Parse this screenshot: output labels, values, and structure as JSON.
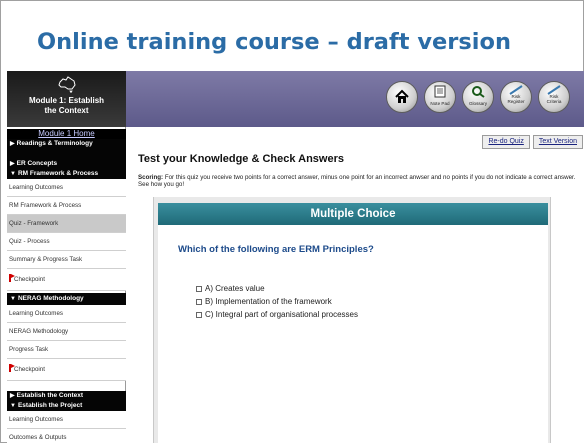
{
  "slide": {
    "title": "Online training course – draft version"
  },
  "brand": {
    "module_line1": "Module 1: Establish",
    "module_line2": "the Context",
    "map_icon": "australia-map-icon"
  },
  "sidebar": {
    "home_link": "Module 1 Home",
    "items": [
      {
        "label": "Readings & Terminology",
        "kind": "section",
        "arrow": "right"
      },
      {
        "label": "ER Concepts",
        "kind": "section",
        "arrow": "right"
      },
      {
        "label": "RM Framework & Process",
        "kind": "section",
        "arrow": "down"
      },
      {
        "label": "Learning Outcomes",
        "kind": "item"
      },
      {
        "label": "RM Framework & Process",
        "kind": "item"
      },
      {
        "label": "Quiz - Framework",
        "kind": "item",
        "active": true
      },
      {
        "label": "Quiz - Process",
        "kind": "item"
      },
      {
        "label": "Summary & Progress Task",
        "kind": "item"
      },
      {
        "label": "Checkpoint",
        "kind": "item",
        "flag": true
      },
      {
        "label": "NERAG Methodology",
        "kind": "section",
        "arrow": "down"
      },
      {
        "label": "Learning Outcomes",
        "kind": "item"
      },
      {
        "label": "NERAG Methodology",
        "kind": "item"
      },
      {
        "label": "Progress Task",
        "kind": "item"
      },
      {
        "label": "Checkpoint",
        "kind": "item",
        "flag": true
      },
      {
        "label": "Establish the Context",
        "kind": "section",
        "arrow": "right"
      },
      {
        "label": "Establish the Project",
        "kind": "section",
        "arrow": "down"
      },
      {
        "label": "Learning Outcomes",
        "kind": "item"
      },
      {
        "label": "Outcomes & Outputs",
        "kind": "item"
      }
    ]
  },
  "toolbar": {
    "home_icon": "home-icon",
    "note_pad": "Note Pad",
    "glossary": "Glossary",
    "risk_register_1": "Risk",
    "risk_register_2": "Register",
    "risk_criteria_1": "Risk",
    "risk_criteria_2": "Criteria"
  },
  "content": {
    "redo_quiz": "Re-do Quiz",
    "text_version": "Text Version",
    "title": "Test your Knowledge & Check Answers",
    "scoring_label": "Scoring:",
    "scoring_text": " For this quiz you receive two points for a correct answer, minus one point for an incorrect anwser and no points if you do not indicate a correct answer. See how you go!"
  },
  "quiz": {
    "header": "Multiple Choice",
    "question": "Which of the following are ERM Principles?",
    "options": [
      "A) Creates value",
      "B) Implementation of the framework",
      "C) Integral part of organisational processes"
    ]
  },
  "colors": {
    "title_blue": "#2b6ca6",
    "header_purple": "#6b6896",
    "quiz_teal": "#2a7f8d"
  }
}
